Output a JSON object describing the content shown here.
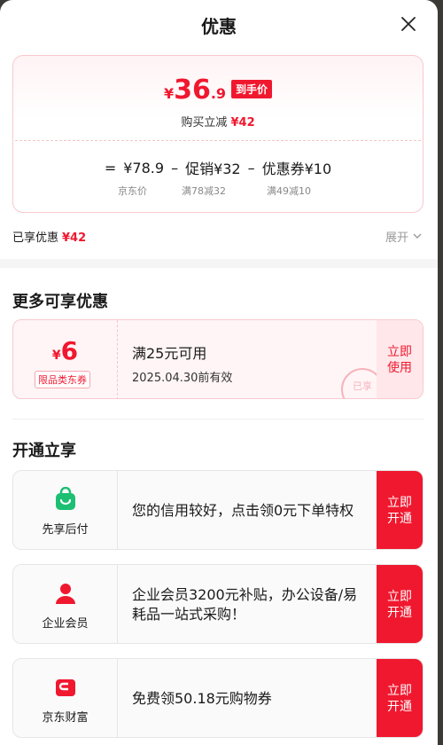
{
  "header": {
    "title": "优惠"
  },
  "price": {
    "currency": "¥",
    "integer": "36",
    "decimal": ".9",
    "tag": "到手价",
    "reduce_text": "购买立减",
    "reduce_amount": "¥42",
    "eq": "=",
    "minus": "–",
    "jd_price": "¥78.9",
    "promo": "促销¥32",
    "coupon": "优惠券¥10",
    "jd_price_label": "京东价",
    "promo_label": "满78减32",
    "coupon_label": "满49减10"
  },
  "enjoyed": {
    "label": "已享优惠",
    "amount": "¥42",
    "expand": "展开"
  },
  "more": {
    "title": "更多可享优惠",
    "coupon": {
      "sym": "¥",
      "amount": "6",
      "tag": "限品类东券",
      "condition": "满25元可用",
      "valid": "2025.04.30前有效",
      "use_label": "立即使用",
      "stamp": "已享"
    }
  },
  "open": {
    "title": "开通立享",
    "items": [
      {
        "name": "先享后付",
        "desc": "您的信用较好，点击领0元下单特权",
        "btn": "立即开通",
        "icon": "bag-icon"
      },
      {
        "name": "企业会员",
        "desc": "企业会员3200元补贴，办公设备/易耗品一站式采购！",
        "btn": "立即开通",
        "icon": "person-icon"
      },
      {
        "name": "京东财富",
        "desc": "免费领50.18元购物券",
        "btn": "立即开通",
        "icon": "wallet-icon"
      }
    ]
  },
  "colors": {
    "accent": "#f0182f",
    "green": "#1dbf73"
  }
}
